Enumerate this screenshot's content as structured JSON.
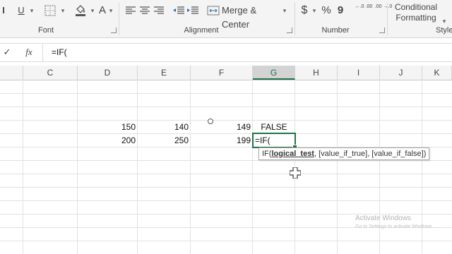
{
  "ribbon": {
    "font": {
      "underline_label": "U",
      "font_color_label": "A",
      "group_label": "Font"
    },
    "alignment": {
      "merge_center_label": "Merge & Center",
      "group_label": "Alignment"
    },
    "number": {
      "currency_label": "$",
      "percent_label": "%",
      "comma_label": "9",
      "increase_decimal_label": "←.0 .00",
      "decrease_decimal_label": ".00 →.0",
      "group_label": "Number"
    },
    "styles": {
      "conditional_formatting_line1": "Conditional",
      "conditional_formatting_line2": "Formatting",
      "group_label": "Style"
    }
  },
  "formula_bar": {
    "enter_icon": "✓",
    "fx_label": "fx",
    "content": "=IF("
  },
  "columns": [
    "C",
    "D",
    "E",
    "F",
    "G",
    "H",
    "I",
    "J",
    "K"
  ],
  "cells": {
    "row6": {
      "D": "150",
      "E": "140",
      "F": "149",
      "G": "FALSE"
    },
    "row7": {
      "D": "200",
      "E": "250",
      "F": "199",
      "G": "=IF("
    }
  },
  "tooltip": {
    "prefix": "IF(",
    "bold_arg": "logical_test",
    "rest": ", [value_if_true], [value_if_false])"
  },
  "watermark": {
    "title": "Activate Windows",
    "subtitle": "Go to Settings to activate Windows."
  },
  "accent_color": "#217346"
}
